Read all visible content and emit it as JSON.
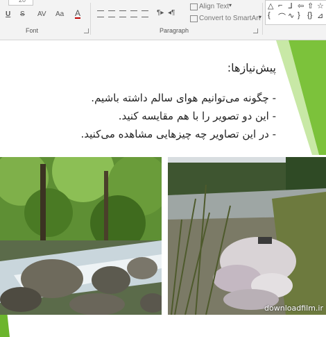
{
  "ribbon": {
    "font_group_label": "Font",
    "paragraph_group_label": "Paragraph",
    "align_text_label": "Align Text",
    "convert_smartart_label": "Convert to SmartArt",
    "font_size_value": "20",
    "underline_label": "U",
    "strike_label": "S",
    "spacing_label": "AV",
    "case_label": "Aa",
    "font_color_label": "A",
    "shape_icons": [
      "triangle-shape-icon",
      "corner-shape-icon",
      "line-shape-icon",
      "block-arrow-icon",
      "star-shape-icon",
      "curly-shape-icon"
    ]
  },
  "slide": {
    "title": "پیش‌نیازها:",
    "bullets": [
      "- چگونه می‌توانیم هوای سالم داشته باشیم.",
      "- این دو تصویر را با هم مقایسه کنید.",
      "- در این تصاویر چه چیزهایی مشاهده می‌کنید."
    ],
    "watermark": "downloadfilm.ir",
    "accent_color": "#6cb52d"
  }
}
